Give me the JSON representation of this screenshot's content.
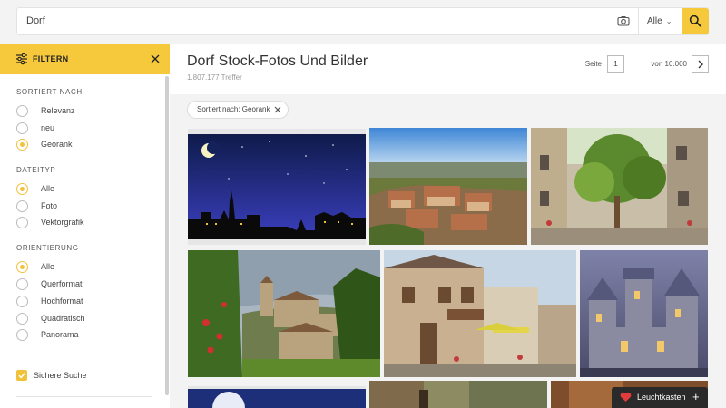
{
  "search": {
    "query": "Dorf",
    "filter_label": "Alle",
    "icons": {
      "camera": "camera-icon",
      "search": "search-icon",
      "chevron": "chevron-down-icon"
    }
  },
  "sidebar": {
    "title": "FILTERN",
    "sections": [
      {
        "label": "SORTIERT NACH",
        "options": [
          "Relevanz",
          "neu",
          "Georank"
        ],
        "selected": "Georank"
      },
      {
        "label": "DATEITYP",
        "options": [
          "Alle",
          "Foto",
          "Vektorgrafik"
        ],
        "selected": "Alle"
      },
      {
        "label": "ORIENTIERUNG",
        "options": [
          "Alle",
          "Querformat",
          "Hochformat",
          "Quadratisch",
          "Panorama"
        ],
        "selected": "Alle"
      }
    ],
    "safe_search": {
      "label": "Sichere Suche",
      "checked": true
    }
  },
  "main": {
    "title": "Dorf Stock-Fotos Und Bilder",
    "hits": "1.807.177 Treffer",
    "pager": {
      "label": "Seite",
      "current": "1",
      "of": "von 10.000"
    },
    "chip": "Sortiert nach: Georank"
  },
  "lightbox": {
    "label": "Leuchtkasten",
    "plus": "+"
  },
  "colors": {
    "accent": "#f6c93d",
    "lightbox_bg": "#2a2a2a",
    "heart": "#e23b3b"
  }
}
